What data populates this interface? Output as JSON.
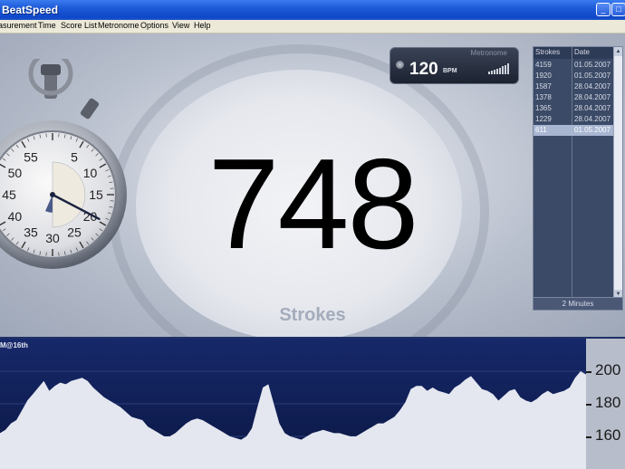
{
  "window": {
    "title": "BeatSpeed",
    "controls": [
      "_",
      "□",
      "×"
    ]
  },
  "menu": [
    "asurement",
    "Time",
    "Score List",
    "Metronome",
    "Options",
    "View",
    "Help"
  ],
  "display": {
    "count": "748",
    "unit_label": "Strokes"
  },
  "metronome": {
    "title": "Metronome",
    "bpm": "120",
    "unit": "BPM"
  },
  "score_list": {
    "headers": [
      "Strokes",
      "Date"
    ],
    "rows": [
      {
        "strokes": "4159",
        "date": "01.05.2007"
      },
      {
        "strokes": "1920",
        "date": "01.05.2007"
      },
      {
        "strokes": "1587",
        "date": "28.04.2007"
      },
      {
        "strokes": "1378",
        "date": "28.04.2007"
      },
      {
        "strokes": "1365",
        "date": "28.04.2007"
      },
      {
        "strokes": "1229",
        "date": "28.04.2007"
      },
      {
        "strokes": "611",
        "date": "01.05.2007"
      }
    ],
    "selected_index": 6,
    "footer": "2 Minutes"
  },
  "stopwatch": {
    "dial_numbers": [
      "5",
      "10",
      "15",
      "20",
      "25",
      "30",
      "35",
      "40",
      "45",
      "50",
      "55"
    ],
    "elapsed_fraction": 0.11
  },
  "graph": {
    "label": "M@16th",
    "y_ticks": [
      "200",
      "180",
      "160"
    ],
    "series": [
      162,
      164,
      168,
      170,
      176,
      182,
      186,
      190,
      194,
      188,
      191,
      193,
      192,
      194,
      195,
      196,
      194,
      190,
      187,
      184,
      182,
      180,
      178,
      175,
      172,
      171,
      170,
      166,
      164,
      162,
      160,
      160,
      162,
      165,
      168,
      170,
      171,
      170,
      168,
      166,
      164,
      162,
      160,
      159,
      158,
      160,
      165,
      178,
      190,
      192,
      180,
      168,
      162,
      160,
      159,
      158,
      160,
      162,
      163,
      164,
      163,
      162,
      162,
      161,
      160,
      160,
      162,
      164,
      166,
      168,
      168,
      170,
      172,
      176,
      181,
      189,
      191,
      191,
      188,
      190,
      188,
      187,
      186,
      190,
      192,
      195,
      197,
      193,
      189,
      188,
      186,
      182,
      185,
      188,
      189,
      184,
      182,
      181,
      183,
      186,
      188,
      186,
      187,
      188,
      190,
      196,
      200,
      198
    ],
    "colors": {
      "fill": "#e4e7f0",
      "bg": "#0c1d4c",
      "axis_bg": "#b7bdca"
    }
  }
}
